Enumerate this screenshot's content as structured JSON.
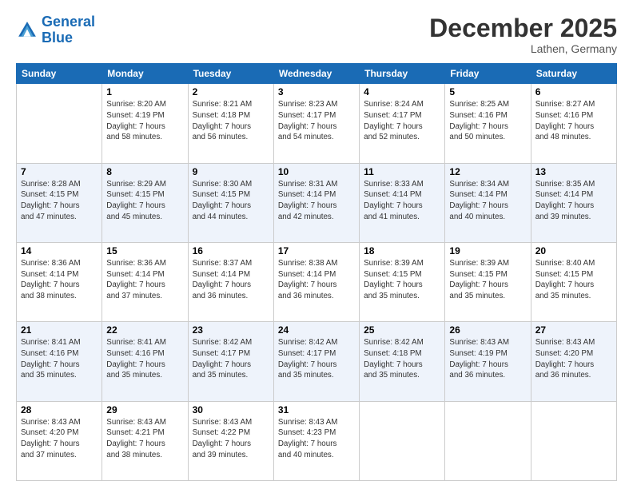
{
  "header": {
    "logo_line1": "General",
    "logo_line2": "Blue",
    "month": "December 2025",
    "location": "Lathen, Germany"
  },
  "weekdays": [
    "Sunday",
    "Monday",
    "Tuesday",
    "Wednesday",
    "Thursday",
    "Friday",
    "Saturday"
  ],
  "weeks": [
    [
      {
        "day": "",
        "info": ""
      },
      {
        "day": "1",
        "info": "Sunrise: 8:20 AM\nSunset: 4:19 PM\nDaylight: 7 hours\nand 58 minutes."
      },
      {
        "day": "2",
        "info": "Sunrise: 8:21 AM\nSunset: 4:18 PM\nDaylight: 7 hours\nand 56 minutes."
      },
      {
        "day": "3",
        "info": "Sunrise: 8:23 AM\nSunset: 4:17 PM\nDaylight: 7 hours\nand 54 minutes."
      },
      {
        "day": "4",
        "info": "Sunrise: 8:24 AM\nSunset: 4:17 PM\nDaylight: 7 hours\nand 52 minutes."
      },
      {
        "day": "5",
        "info": "Sunrise: 8:25 AM\nSunset: 4:16 PM\nDaylight: 7 hours\nand 50 minutes."
      },
      {
        "day": "6",
        "info": "Sunrise: 8:27 AM\nSunset: 4:16 PM\nDaylight: 7 hours\nand 48 minutes."
      }
    ],
    [
      {
        "day": "7",
        "info": "Sunrise: 8:28 AM\nSunset: 4:15 PM\nDaylight: 7 hours\nand 47 minutes."
      },
      {
        "day": "8",
        "info": "Sunrise: 8:29 AM\nSunset: 4:15 PM\nDaylight: 7 hours\nand 45 minutes."
      },
      {
        "day": "9",
        "info": "Sunrise: 8:30 AM\nSunset: 4:15 PM\nDaylight: 7 hours\nand 44 minutes."
      },
      {
        "day": "10",
        "info": "Sunrise: 8:31 AM\nSunset: 4:14 PM\nDaylight: 7 hours\nand 42 minutes."
      },
      {
        "day": "11",
        "info": "Sunrise: 8:33 AM\nSunset: 4:14 PM\nDaylight: 7 hours\nand 41 minutes."
      },
      {
        "day": "12",
        "info": "Sunrise: 8:34 AM\nSunset: 4:14 PM\nDaylight: 7 hours\nand 40 minutes."
      },
      {
        "day": "13",
        "info": "Sunrise: 8:35 AM\nSunset: 4:14 PM\nDaylight: 7 hours\nand 39 minutes."
      }
    ],
    [
      {
        "day": "14",
        "info": "Sunrise: 8:36 AM\nSunset: 4:14 PM\nDaylight: 7 hours\nand 38 minutes."
      },
      {
        "day": "15",
        "info": "Sunrise: 8:36 AM\nSunset: 4:14 PM\nDaylight: 7 hours\nand 37 minutes."
      },
      {
        "day": "16",
        "info": "Sunrise: 8:37 AM\nSunset: 4:14 PM\nDaylight: 7 hours\nand 36 minutes."
      },
      {
        "day": "17",
        "info": "Sunrise: 8:38 AM\nSunset: 4:14 PM\nDaylight: 7 hours\nand 36 minutes."
      },
      {
        "day": "18",
        "info": "Sunrise: 8:39 AM\nSunset: 4:15 PM\nDaylight: 7 hours\nand 35 minutes."
      },
      {
        "day": "19",
        "info": "Sunrise: 8:39 AM\nSunset: 4:15 PM\nDaylight: 7 hours\nand 35 minutes."
      },
      {
        "day": "20",
        "info": "Sunrise: 8:40 AM\nSunset: 4:15 PM\nDaylight: 7 hours\nand 35 minutes."
      }
    ],
    [
      {
        "day": "21",
        "info": "Sunrise: 8:41 AM\nSunset: 4:16 PM\nDaylight: 7 hours\nand 35 minutes."
      },
      {
        "day": "22",
        "info": "Sunrise: 8:41 AM\nSunset: 4:16 PM\nDaylight: 7 hours\nand 35 minutes."
      },
      {
        "day": "23",
        "info": "Sunrise: 8:42 AM\nSunset: 4:17 PM\nDaylight: 7 hours\nand 35 minutes."
      },
      {
        "day": "24",
        "info": "Sunrise: 8:42 AM\nSunset: 4:17 PM\nDaylight: 7 hours\nand 35 minutes."
      },
      {
        "day": "25",
        "info": "Sunrise: 8:42 AM\nSunset: 4:18 PM\nDaylight: 7 hours\nand 35 minutes."
      },
      {
        "day": "26",
        "info": "Sunrise: 8:43 AM\nSunset: 4:19 PM\nDaylight: 7 hours\nand 36 minutes."
      },
      {
        "day": "27",
        "info": "Sunrise: 8:43 AM\nSunset: 4:20 PM\nDaylight: 7 hours\nand 36 minutes."
      }
    ],
    [
      {
        "day": "28",
        "info": "Sunrise: 8:43 AM\nSunset: 4:20 PM\nDaylight: 7 hours\nand 37 minutes."
      },
      {
        "day": "29",
        "info": "Sunrise: 8:43 AM\nSunset: 4:21 PM\nDaylight: 7 hours\nand 38 minutes."
      },
      {
        "day": "30",
        "info": "Sunrise: 8:43 AM\nSunset: 4:22 PM\nDaylight: 7 hours\nand 39 minutes."
      },
      {
        "day": "31",
        "info": "Sunrise: 8:43 AM\nSunset: 4:23 PM\nDaylight: 7 hours\nand 40 minutes."
      },
      {
        "day": "",
        "info": ""
      },
      {
        "day": "",
        "info": ""
      },
      {
        "day": "",
        "info": ""
      }
    ]
  ]
}
